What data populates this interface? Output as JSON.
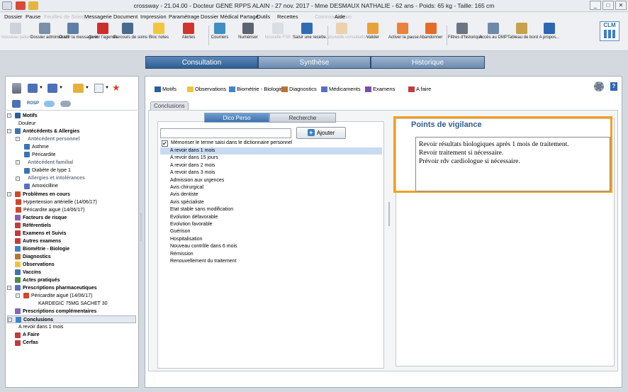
{
  "window": {
    "title": "crossway - 21.04.00 - Docteur GENE RPPS ALAIN - 27 nov. 2017 - Mme DESMAUX NATHALIE - 62 ans - Poids: 65 kg - Taille: 165 cm",
    "controls": [
      "_",
      "□",
      "✕"
    ]
  },
  "menu": [
    {
      "label": "Dossier",
      "disabled": false
    },
    {
      "label": "Pause",
      "disabled": false
    },
    {
      "label": "Feuilles de Soins",
      "disabled": true
    },
    {
      "label": "Messagerie",
      "disabled": false
    },
    {
      "label": "Document",
      "disabled": false
    },
    {
      "label": "Impression",
      "disabled": false
    },
    {
      "label": "Paramétrage",
      "disabled": false
    },
    {
      "label": "Dossier Médical Partagé",
      "disabled": false
    },
    {
      "label": "Outils",
      "disabled": false
    },
    {
      "label": "Recettes",
      "disabled": false
    },
    {
      "label": "Communication",
      "disabled": true
    },
    {
      "label": "Aide",
      "disabled": false
    }
  ],
  "toolbar": [
    {
      "label": "Nouveau patient",
      "icon": "new-patient-icon",
      "color": "#9aa5b3",
      "disabled": true
    },
    {
      "label": "Dossier administratif",
      "icon": "admin-folder-icon",
      "color": "#7a8fa8",
      "disabled": false
    },
    {
      "label": "Ouvrir la messagerie",
      "icon": "mail-icon",
      "color": "#5d7fa6",
      "disabled": false
    },
    {
      "label": "Ouvrir l'agenda",
      "icon": "calendar-icon",
      "color": "#c9302c",
      "disabled": false
    },
    {
      "label": "Parcours de soins",
      "icon": "care-path-icon",
      "color": "#4a6b8f",
      "disabled": false
    },
    {
      "label": "Bloc notes",
      "icon": "notepad-icon",
      "color": "#f3c640",
      "disabled": false
    },
    {
      "label": "Alertes",
      "icon": "alert-icon",
      "color": "#d1342f",
      "disabled": false
    },
    {
      "label": "Courriers",
      "icon": "letters-icon",
      "color": "#3f8ec4",
      "disabled": false
    },
    {
      "label": "Numériser",
      "icon": "scanner-icon",
      "color": "#5c6470",
      "disabled": false
    },
    {
      "label": "Nouvelle FSE",
      "icon": "fse-icon",
      "color": "#b8c2cf",
      "disabled": true
    },
    {
      "label": "Saisir une recette...",
      "icon": "euro-icon",
      "color": "#2f6db3",
      "disabled": false
    },
    {
      "label": "Nouvelle consultation",
      "icon": "consultation-icon",
      "color": "#e7a243",
      "disabled": true
    },
    {
      "label": "Valider",
      "icon": "validate-icon",
      "color": "#e9a13b",
      "disabled": false
    },
    {
      "label": "Activer la pause",
      "icon": "pause-icon",
      "color": "#e9823b",
      "disabled": false
    },
    {
      "label": "Abandonner",
      "icon": "abandon-icon",
      "color": "#e46b2c",
      "disabled": false
    },
    {
      "label": "Filtres d'historique",
      "icon": "printer-filter-icon",
      "color": "#6b7583",
      "disabled": false
    },
    {
      "label": "Accès au DMP",
      "icon": "dmp-icon",
      "color": "#6f89aa",
      "disabled": false
    },
    {
      "label": "Tableau de bord",
      "icon": "dashboard-icon",
      "color": "#c7a24a",
      "disabled": false
    },
    {
      "label": "A propos...",
      "icon": "help-icon",
      "color": "#2d67b0",
      "disabled": false
    }
  ],
  "logo": {
    "text": "CLM"
  },
  "main_tabs": [
    {
      "label": "Consultation",
      "active": true
    },
    {
      "label": "Synthèse",
      "active": false
    },
    {
      "label": "Historique",
      "active": false
    }
  ],
  "left_icons": {
    "rosp": "ROSP"
  },
  "tree": [
    {
      "label": "Motifs",
      "level": 0,
      "bold": true,
      "exp": "⊟",
      "icon": "motif-icon",
      "color": "#2a5d9e"
    },
    {
      "label": "Douleur",
      "level": 1,
      "bold": false,
      "exp": "",
      "icon": "",
      "color": ""
    },
    {
      "label": "Antécédents & Allergies",
      "level": 0,
      "bold": true,
      "exp": "⊟",
      "icon": "antecedent-icon",
      "color": "#3a74b5"
    },
    {
      "label": "Antécédent personnel",
      "level": 1,
      "group": true,
      "exp": "⊟"
    },
    {
      "label": "Asthme",
      "level": 2,
      "bold": false,
      "exp": "",
      "icon": "person-icon",
      "color": "#3a74b5"
    },
    {
      "label": "Péricardite",
      "level": 2,
      "bold": false,
      "exp": "",
      "icon": "person-icon",
      "color": "#3a74b5"
    },
    {
      "label": "Antécédent familial",
      "level": 1,
      "group": true,
      "exp": "⊟"
    },
    {
      "label": "Diabète de type 1",
      "level": 2,
      "bold": false,
      "exp": "",
      "icon": "family-icon",
      "color": "#3a74b5"
    },
    {
      "label": "Allergies et intolérances",
      "level": 1,
      "group": true,
      "exp": "⊟"
    },
    {
      "label": "Amoxicilline",
      "level": 2,
      "bold": false,
      "exp": "",
      "icon": "allergy-icon",
      "color": "#5b6fc0"
    },
    {
      "label": "Problèmes en cours",
      "level": 0,
      "bold": true,
      "exp": "⊟",
      "icon": "star-icon",
      "color": "#d2462b"
    },
    {
      "label": "Hypertension artérielle (14/06/17)",
      "level": 1,
      "bold": false,
      "exp": "",
      "icon": "star-icon",
      "color": "#d2462b"
    },
    {
      "label": "Péricardite aiguë (14/06/17)",
      "level": 1,
      "bold": false,
      "exp": "",
      "icon": "star-icon",
      "color": "#d2462b"
    },
    {
      "label": "Facteurs de risque",
      "level": 0,
      "bold": true,
      "exp": "",
      "icon": "risk-icon",
      "color": "#8c5bb0"
    },
    {
      "label": "Référentiels",
      "level": 0,
      "bold": true,
      "exp": "",
      "icon": "checklist-icon",
      "color": "#c43b3b"
    },
    {
      "label": "Examens et Suivis",
      "level": 0,
      "bold": true,
      "exp": "",
      "icon": "checklist-icon",
      "color": "#c43b3b"
    },
    {
      "label": "Autres examens",
      "level": 0,
      "bold": true,
      "exp": "",
      "icon": "checklist-icon",
      "color": "#c43b3b"
    },
    {
      "label": "Biométrie - Biologie",
      "level": 0,
      "bold": true,
      "exp": "",
      "icon": "biometry-icon",
      "color": "#3e86c9"
    },
    {
      "label": "Diagnostics",
      "level": 0,
      "bold": true,
      "exp": "",
      "icon": "diagnostic-icon",
      "color": "#b7752d"
    },
    {
      "label": "Observations",
      "level": 0,
      "bold": true,
      "exp": "",
      "icon": "observation-icon",
      "color": "#f0c43a"
    },
    {
      "label": "Vaccins",
      "level": 0,
      "bold": true,
      "exp": "",
      "icon": "vaccine-icon",
      "color": "#3a74b5"
    },
    {
      "label": "Actes pratiqués",
      "level": 0,
      "bold": true,
      "exp": "",
      "icon": "acts-icon",
      "color": "#4a8f4a"
    },
    {
      "label": "Prescriptions pharmaceutiques",
      "level": 0,
      "bold": true,
      "exp": "⊟",
      "icon": "pill-icon",
      "color": "#5b6fc0"
    },
    {
      "label": "Péricardite aiguë (14/06/17)",
      "level": 1,
      "bold": false,
      "exp": "⊟",
      "icon": "star-icon",
      "color": "#d2462b"
    },
    {
      "label": "KARDEGIC 75MG SACHET 30",
      "level": 3,
      "bold": false,
      "exp": "",
      "icon": "",
      "color": ""
    },
    {
      "label": "Prescriptions complémentaires",
      "level": 0,
      "bold": true,
      "exp": "",
      "icon": "pill-icon",
      "color": "#8a64b5"
    },
    {
      "label": "Conclusions",
      "level": 0,
      "bold": true,
      "exp": "⊟",
      "icon": "conclusion-icon",
      "color": "#3e86c9",
      "selected": true
    },
    {
      "label": "A revoir dans 1 mois",
      "level": 1,
      "bold": false,
      "exp": "",
      "icon": "",
      "color": ""
    },
    {
      "label": "A Faire",
      "level": 0,
      "bold": true,
      "exp": "",
      "icon": "todo-icon",
      "color": "#c43b3b"
    },
    {
      "label": "Cerfas",
      "level": 0,
      "bold": true,
      "exp": "",
      "icon": "cerfa-icon",
      "color": "#c43b3b"
    }
  ],
  "section_tabs": [
    {
      "label": "Motifs",
      "icon": "motif-icon",
      "color": "#2a5d9e"
    },
    {
      "label": "Observations",
      "icon": "observation-icon",
      "color": "#f0c43a"
    },
    {
      "label": "Biométrie - Biologie",
      "icon": "biometry-icon",
      "color": "#3e86c9"
    },
    {
      "label": "Diagnostics",
      "icon": "diagnostic-icon",
      "color": "#b7752d"
    },
    {
      "label": "Médicaments",
      "icon": "pill-icon",
      "color": "#5b6fc0"
    },
    {
      "label": "Examens",
      "icon": "exam-icon",
      "color": "#7a4fa8"
    },
    {
      "label": "A faire",
      "icon": "todo-icon",
      "color": "#c43b3b"
    }
  ],
  "section": {
    "title": "Conclusions",
    "subtabs": [
      {
        "label": "Dico Perso",
        "active": true
      },
      {
        "label": "Recherche",
        "active": false
      }
    ],
    "search_value": "",
    "add_label": "Ajouter",
    "memorize_label": "Mémoriser le terme saisi dans le dictionnaire personnel",
    "memorize_checked": true,
    "items": [
      "A revoir dans 1 mois",
      "A revoir dans 15 jours",
      "A revoir dans 2 mois",
      "A revoir dans 3 mois",
      "Admission aux urgences",
      "Avis chirurgical",
      "Avis dentiste",
      "Avis spécialiste",
      "Etat stable sans modification",
      "Evolution défavorable",
      "Evolution favorable",
      "Guérison",
      "Hospitalisation",
      "Nouveau contrôle dans 6 mois",
      "Rémission",
      "Renouvellement du traitement"
    ],
    "selected_index": 0
  },
  "vigilance": {
    "title": "Points de vigilance",
    "lines": [
      "Revoir résultats biologiques après 1 mois de traitement.",
      "Revoir traitement si nécessaire.",
      "Prévoir rdv cardiologue si nécessaire."
    ]
  }
}
